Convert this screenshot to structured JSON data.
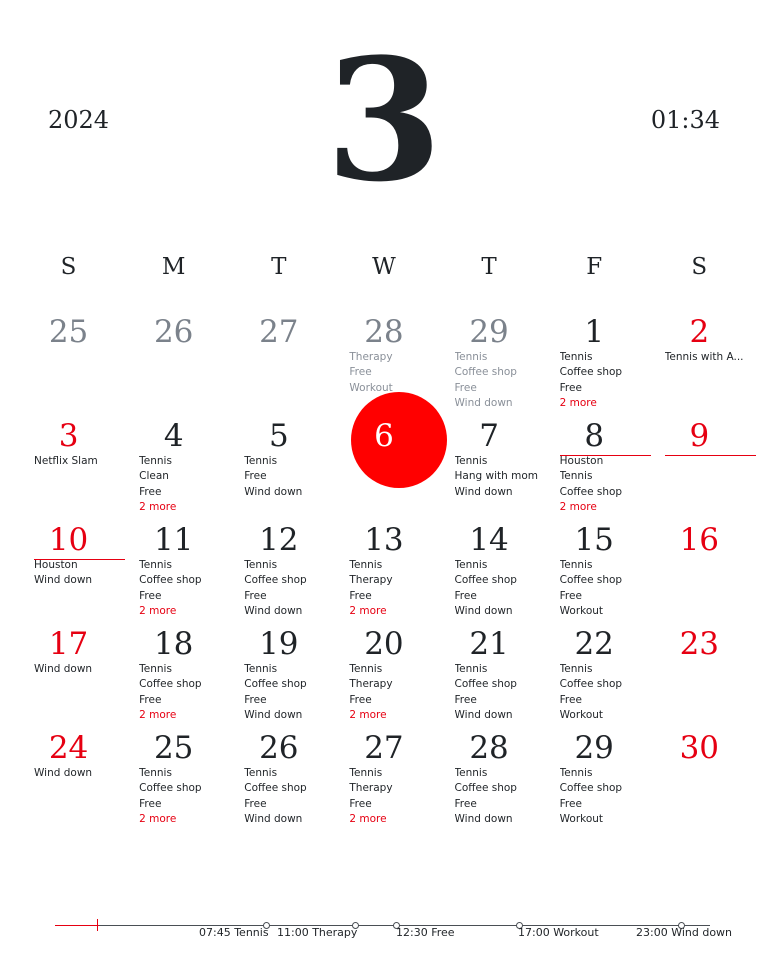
{
  "header": {
    "year": "2024",
    "month": "3",
    "time": "01:34"
  },
  "weekdays": [
    "S",
    "M",
    "T",
    "W",
    "T",
    "F",
    "S"
  ],
  "weeks": [
    [
      {
        "day": "25",
        "type": "other",
        "events": []
      },
      {
        "day": "26",
        "type": "other",
        "events": []
      },
      {
        "day": "27",
        "type": "other",
        "events": []
      },
      {
        "day": "28",
        "type": "other",
        "events": [
          "Therapy",
          "Free",
          "Workout"
        ]
      },
      {
        "day": "29",
        "type": "other",
        "events": [
          "Tennis",
          "Coffee shop",
          "Free",
          "Wind down"
        ]
      },
      {
        "day": "1",
        "type": "normal",
        "events": [
          "Tennis",
          "Coffee shop",
          "Free"
        ],
        "more": "2 more"
      },
      {
        "day": "2",
        "type": "sat",
        "events": [
          "Tennis with A..."
        ]
      }
    ],
    [
      {
        "day": "3",
        "type": "sun",
        "events": [
          "Netflix Slam"
        ]
      },
      {
        "day": "4",
        "type": "normal",
        "events": [
          "Tennis",
          "Clean",
          "Free"
        ],
        "more": "2 more"
      },
      {
        "day": "5",
        "type": "normal",
        "events": [
          "Tennis",
          "Free",
          "Wind down"
        ]
      },
      {
        "day": "6",
        "type": "today",
        "events": []
      },
      {
        "day": "7",
        "type": "normal",
        "events": [
          "Tennis",
          "Hang with mom",
          "Wind down"
        ]
      },
      {
        "day": "8",
        "type": "normal",
        "underline": true,
        "events": [
          "Houston",
          "Tennis",
          "Coffee shop"
        ],
        "more": "2 more"
      },
      {
        "day": "9",
        "type": "sat",
        "underline": true,
        "events": []
      }
    ],
    [
      {
        "day": "10",
        "type": "sun",
        "underline": true,
        "events": [
          "Houston",
          "Wind down"
        ]
      },
      {
        "day": "11",
        "type": "normal",
        "events": [
          "Tennis",
          "Coffee shop",
          "Free"
        ],
        "more": "2 more"
      },
      {
        "day": "12",
        "type": "normal",
        "events": [
          "Tennis",
          "Coffee shop",
          "Free",
          "Wind down"
        ]
      },
      {
        "day": "13",
        "type": "normal",
        "events": [
          "Tennis",
          "Therapy",
          "Free"
        ],
        "more": "2 more"
      },
      {
        "day": "14",
        "type": "normal",
        "events": [
          "Tennis",
          "Coffee shop",
          "Free",
          "Wind down"
        ]
      },
      {
        "day": "15",
        "type": "normal",
        "events": [
          "Tennis",
          "Coffee shop",
          "Free",
          "Workout"
        ]
      },
      {
        "day": "16",
        "type": "sat",
        "events": []
      }
    ],
    [
      {
        "day": "17",
        "type": "sun",
        "events": [
          "Wind down"
        ]
      },
      {
        "day": "18",
        "type": "normal",
        "events": [
          "Tennis",
          "Coffee shop",
          "Free"
        ],
        "more": "2 more"
      },
      {
        "day": "19",
        "type": "normal",
        "events": [
          "Tennis",
          "Coffee shop",
          "Free",
          "Wind down"
        ]
      },
      {
        "day": "20",
        "type": "normal",
        "events": [
          "Tennis",
          "Therapy",
          "Free"
        ],
        "more": "2 more"
      },
      {
        "day": "21",
        "type": "normal",
        "events": [
          "Tennis",
          "Coffee shop",
          "Free",
          "Wind down"
        ]
      },
      {
        "day": "22",
        "type": "normal",
        "events": [
          "Tennis",
          "Coffee shop",
          "Free",
          "Workout"
        ]
      },
      {
        "day": "23",
        "type": "sat",
        "events": []
      }
    ],
    [
      {
        "day": "24",
        "type": "sun",
        "events": [
          "Wind down"
        ]
      },
      {
        "day": "25",
        "type": "normal",
        "events": [
          "Tennis",
          "Coffee shop",
          "Free"
        ],
        "more": "2 more"
      },
      {
        "day": "26",
        "type": "normal",
        "events": [
          "Tennis",
          "Coffee shop",
          "Free",
          "Wind down"
        ]
      },
      {
        "day": "27",
        "type": "normal",
        "events": [
          "Tennis",
          "Therapy",
          "Free"
        ],
        "more": "2 more"
      },
      {
        "day": "28",
        "type": "normal",
        "events": [
          "Tennis",
          "Coffee shop",
          "Free",
          "Wind down"
        ]
      },
      {
        "day": "29",
        "type": "normal",
        "events": [
          "Tennis",
          "Coffee shop",
          "Free",
          "Workout"
        ]
      },
      {
        "day": "30",
        "type": "sat",
        "events": []
      }
    ]
  ],
  "timeline": {
    "items": [
      "07:45 Tennis",
      "11:00 Therapy",
      "12:30 Free",
      "17:00 Workout",
      "23:00 Wind down"
    ]
  },
  "colors": {
    "accent": "#e60012",
    "today": "#ff0000",
    "text": "#1f2327",
    "muted": "#7b828b"
  }
}
